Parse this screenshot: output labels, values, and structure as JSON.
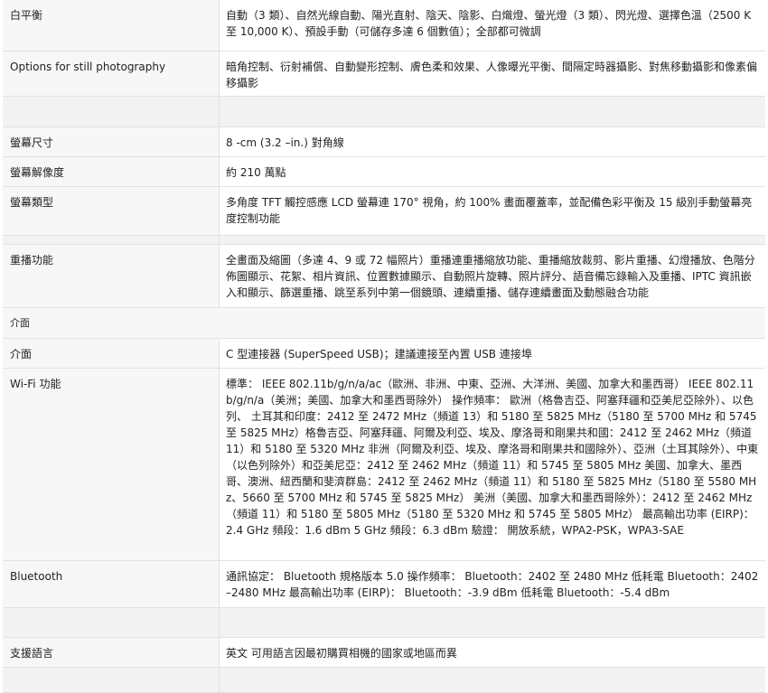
{
  "rows": [
    {
      "label": "白平衡",
      "value": "自動（3 類）、自然光線自動、陽光直射、陰天、陰影、白熾燈、螢光燈（3 類）、閃光燈、選擇色溫（2500 K 至 10,000 K）、預設手動（可儲存多達 6 個數值）；全部都可微調"
    },
    {
      "label": "Options for still photography",
      "value": "暗角控制、衍射補償、自動變形控制、膚色柔和效果、人像曝光平衡、間隔定時器攝影、對焦移動攝影和像素偏移攝影"
    },
    {
      "label": "螢幕尺寸",
      "value": "8 -cm (3.2 –in.) 對角線"
    },
    {
      "label": "螢幕解像度",
      "value": "約 210 萬點"
    },
    {
      "label": "螢幕類型",
      "value": "多角度 TFT 觸控感應 LCD 螢幕連 170° 視角，約 100% 畫面覆蓋率，並配備色彩平衡及 15 級別手動螢幕亮度控制功能"
    },
    {
      "label": "重播功能",
      "value": "全畫面及縮圖（多達 4、9 或 72 幅照片）重播連重播縮放功能、重播縮放裁剪、影片重播、幻燈播放、色階分佈圖顯示、花絮、相片資訊、位置數據顯示、自動照片旋轉、照片評分、語音備忘錄輸入及重播、IPTC 資訊嵌入和顯示、篩選重播、跳至系列中第一個鏡頭、連續重播、儲存連續畫面及動態融合功能"
    },
    {
      "section": "介面"
    },
    {
      "label": "介面",
      "value": "C 型連接器 (SuperSpeed USB)；建議連接至內置 USB 連接埠"
    },
    {
      "label": "Wi-Fi 功能",
      "value": "標準： IEEE 802.11b/g/n/a/ac（歐洲、非洲、中東、亞洲、大洋洲、美國、加拿大和墨西哥） IEEE 802.11b/g/n/a（美洲；美國、加拿大和墨西哥除外） 操作頻率： 歐洲（格魯吉亞、阿塞拜疆和亞美尼亞除外）、以色列、 土耳其和印度：2412 至 2472 MHz（頻道 13）和 5180 至 5825 MHz（5180 至 5700 MHz 和 5745 至 5825 MHz）格魯吉亞、阿塞拜疆、阿爾及利亞、埃及、摩洛哥和剛果共和國：2412 至 2462 MHz（頻道 11）和 5180 至 5320 MHz 非洲（阿爾及利亞、埃及、摩洛哥和剛果共和國除外）、亞洲（土耳其除外）、中東（以色列除外）和亞美尼亞：2412 至 2462 MHz（頻道 11）和 5745 至 5805 MHz 美國、加拿大、墨西哥、澳洲、紐西蘭和斐濟群島：2412 至 2462 MHz（頻道 11）和 5180 至 5825 MHz（5180 至 5580 MHz、5660 至 5700 MHz 和 5745 至 5825 MHz） 美洲（美國、加拿大和墨西哥除外）：2412 至 2462 MHz（頻道 11）和 5180 至 5805 MHz（5180 至 5320 MHz 和 5745 至 5805 MHz） 最高輸出功率 (EIRP)： 2.4 GHz 頻段：1.6 dBm 5 GHz 頻段：6.3 dBm 驗證： 開放系統，WPA2-PSK，WPA3-SAE"
    },
    {
      "label": "Bluetooth",
      "value": "通訊協定： Bluetooth 規格版本 5.0 操作頻率： Bluetooth：2402 至 2480 MHz 低耗電 Bluetooth：2402–2480 MHz 最高輸出功率 (EIRP)： Bluetooth：-3.9 dBm 低耗電 Bluetooth：-5.4 dBm"
    },
    {
      "label": "支援語言",
      "value": "英文 可用語言因最初購買相機的國家或地區而異"
    }
  ]
}
